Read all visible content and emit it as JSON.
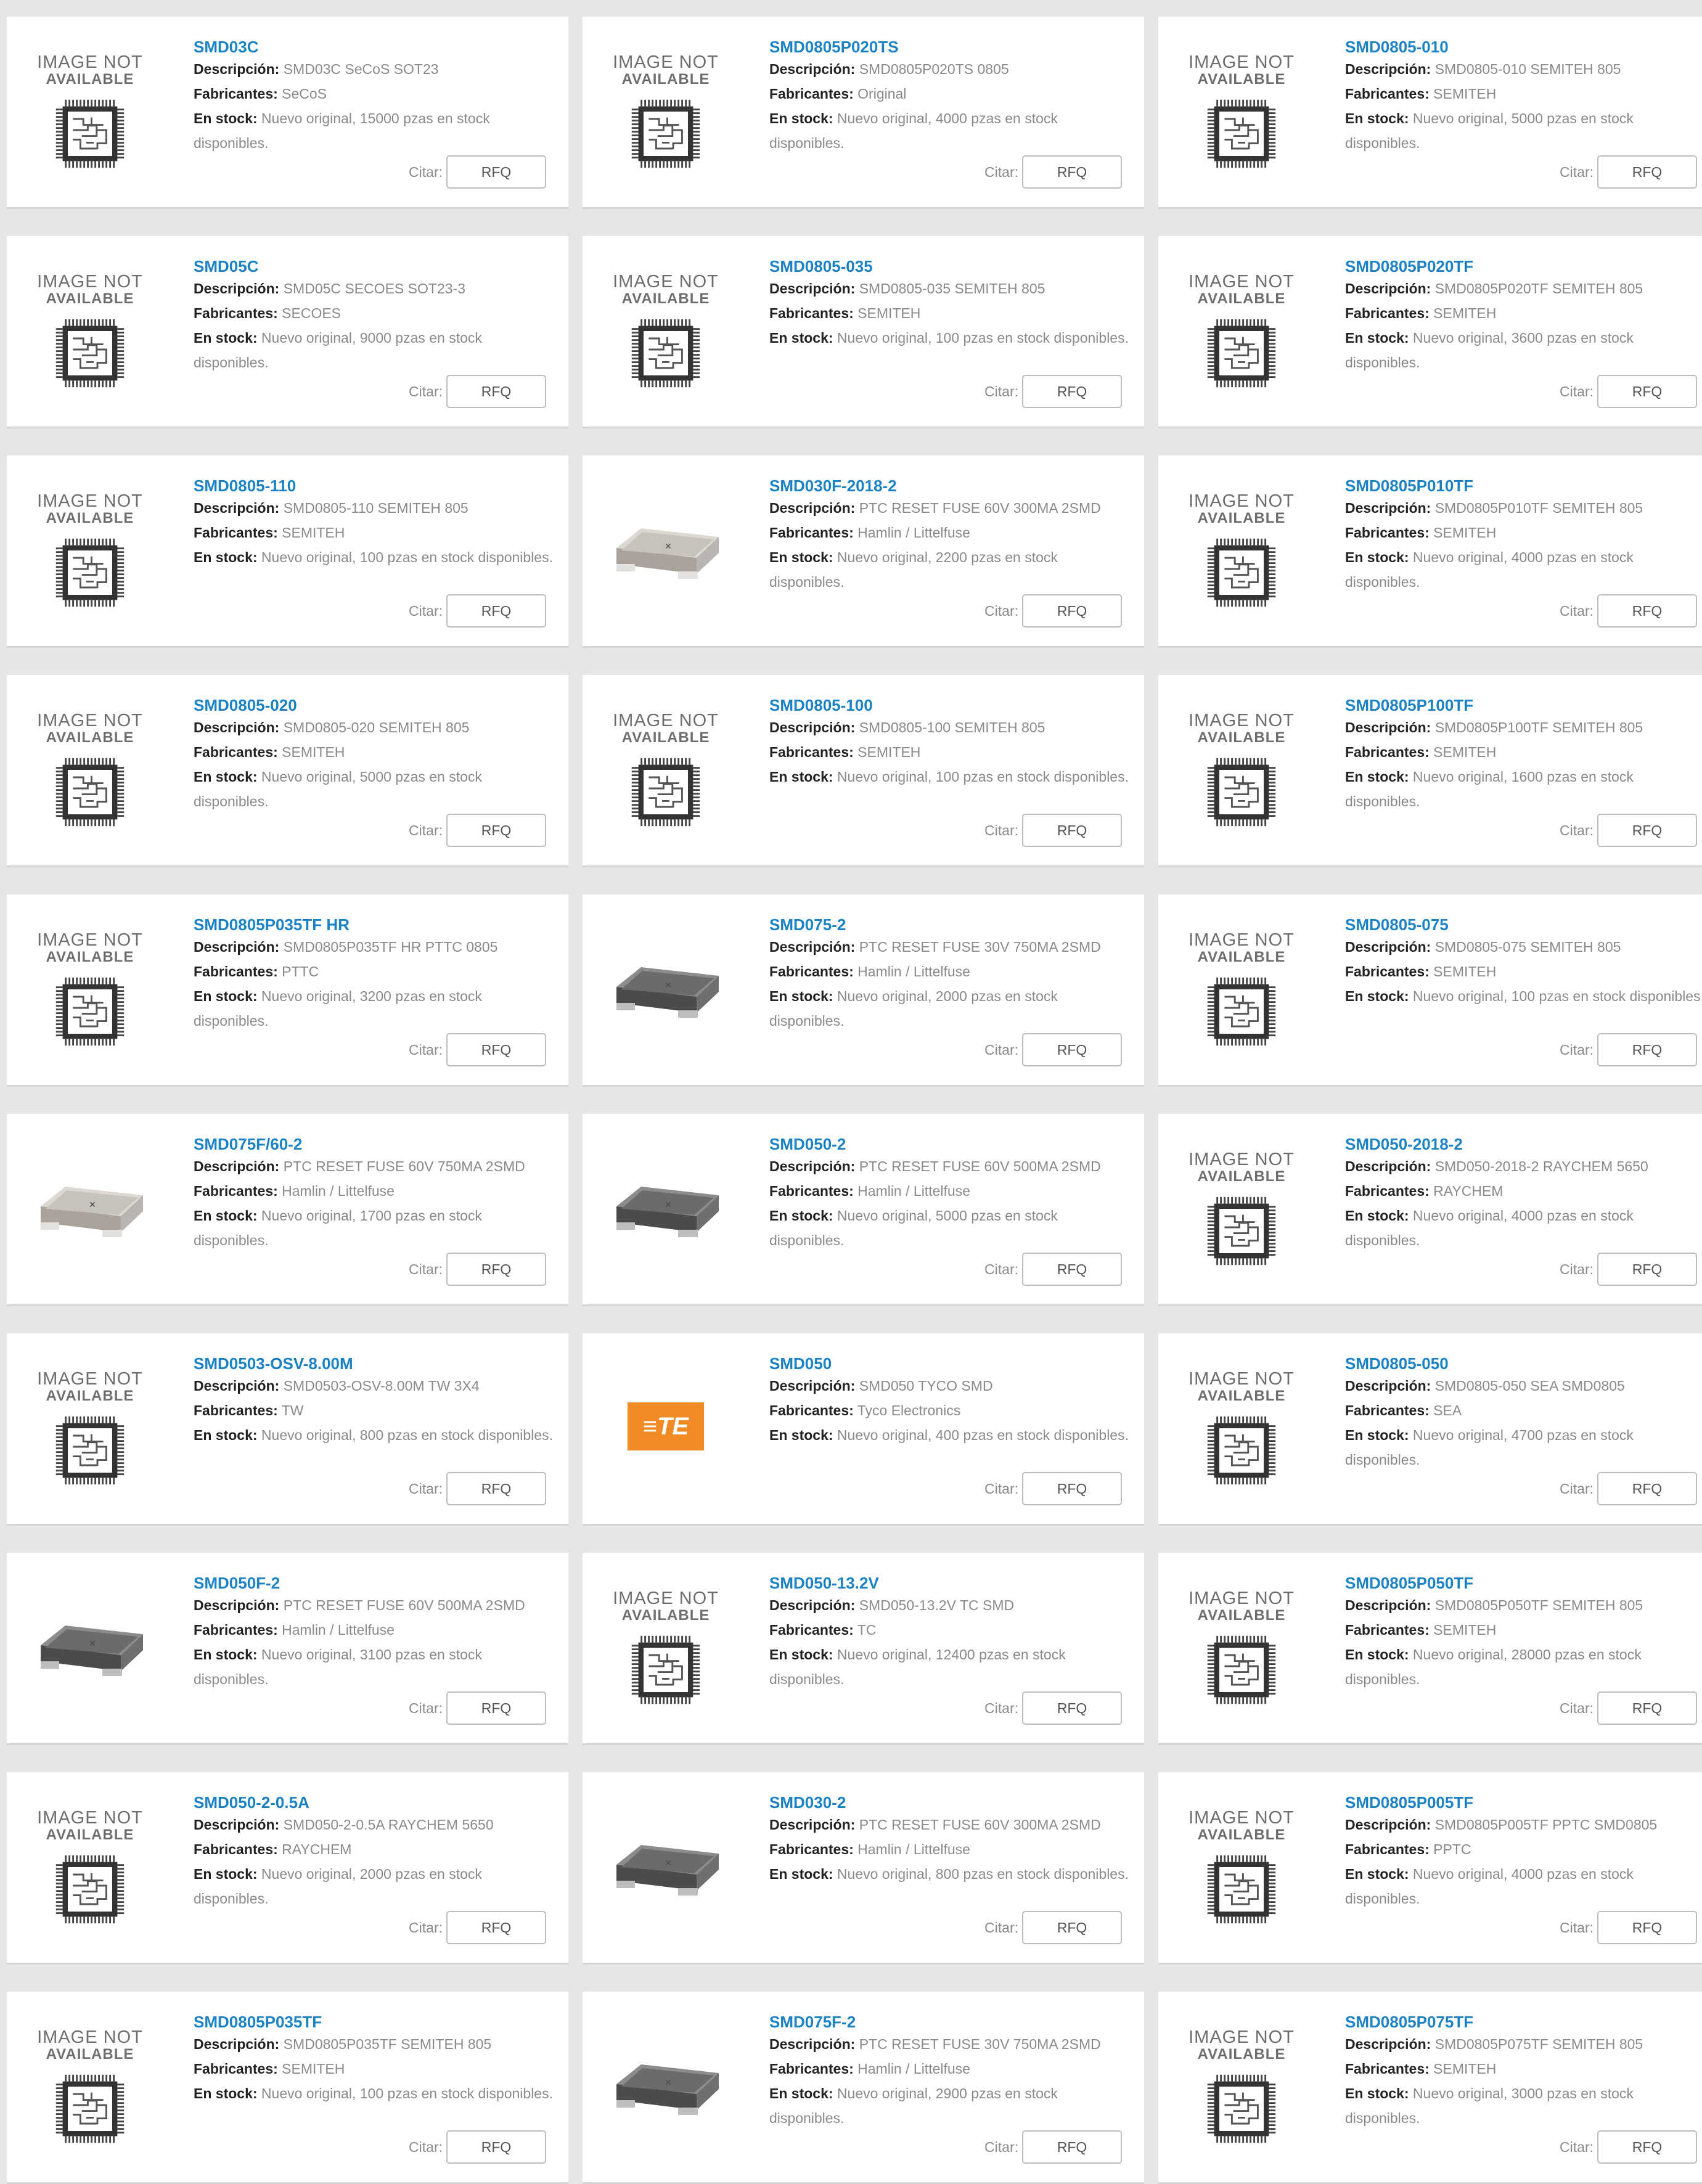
{
  "labels": {
    "description": "Descripción:",
    "manufacturers": "Fabricantes:",
    "in_stock": "En stock:",
    "cite": "Citar:",
    "rfq": "RFQ",
    "image_na_line1": "IMAGE NOT",
    "image_na_line2": "AVAILABLE",
    "te_logo_text": "≡TE"
  },
  "products": [
    {
      "name": "SMD03C",
      "description": "SMD03C SeCoS SOT23",
      "manufacturer": "SeCoS",
      "stock": "Nuevo original, 15000 pzas en stock disponibles.",
      "image": "not-available"
    },
    {
      "name": "SMD0805P020TS",
      "description": "SMD0805P020TS 0805",
      "manufacturer": "Original",
      "stock": "Nuevo original, 4000 pzas en stock disponibles.",
      "image": "not-available"
    },
    {
      "name": "SMD0805-010",
      "description": "SMD0805-010 SEMITEH 805",
      "manufacturer": "SEMITEH",
      "stock": "Nuevo original, 5000 pzas en stock disponibles.",
      "image": "not-available"
    },
    {
      "name": "SMD05C",
      "description": "SMD05C SECOES SOT23-3",
      "manufacturer": "SECOES",
      "stock": "Nuevo original, 9000 pzas en stock disponibles.",
      "image": "not-available"
    },
    {
      "name": "SMD0805-035",
      "description": "SMD0805-035 SEMITEH 805",
      "manufacturer": "SEMITEH",
      "stock": "Nuevo original, 100 pzas en stock disponibles.",
      "image": "not-available"
    },
    {
      "name": "SMD0805P020TF",
      "description": "SMD0805P020TF SEMITEH 805",
      "manufacturer": "SEMITEH",
      "stock": "Nuevo original, 3600 pzas en stock disponibles.",
      "image": "not-available"
    },
    {
      "name": "SMD0805-110",
      "description": "SMD0805-110 SEMITEH 805",
      "manufacturer": "SEMITEH",
      "stock": "Nuevo original, 100 pzas en stock disponibles.",
      "image": "not-available"
    },
    {
      "name": "SMD030F-2018-2",
      "description": "PTC RESET FUSE 60V 300MA 2SMD",
      "manufacturer": "Hamlin / Littelfuse",
      "stock": "Nuevo original, 2200 pzas en stock disponibles.",
      "image": "fuse-light"
    },
    {
      "name": "SMD0805P010TF",
      "description": "SMD0805P010TF SEMITEH 805",
      "manufacturer": "SEMITEH",
      "stock": "Nuevo original, 4000 pzas en stock disponibles.",
      "image": "not-available"
    },
    {
      "name": "SMD0805-020",
      "description": "SMD0805-020 SEMITEH 805",
      "manufacturer": "SEMITEH",
      "stock": "Nuevo original, 5000 pzas en stock disponibles.",
      "image": "not-available"
    },
    {
      "name": "SMD0805-100",
      "description": "SMD0805-100 SEMITEH 805",
      "manufacturer": "SEMITEH",
      "stock": "Nuevo original, 100 pzas en stock disponibles.",
      "image": "not-available"
    },
    {
      "name": "SMD0805P100TF",
      "description": "SMD0805P100TF SEMITEH 805",
      "manufacturer": "SEMITEH",
      "stock": "Nuevo original, 1600 pzas en stock disponibles.",
      "image": "not-available"
    },
    {
      "name": "SMD0805P035TF HR",
      "description": "SMD0805P035TF HR PTTC 0805",
      "manufacturer": "PTTC",
      "stock": "Nuevo original, 3200 pzas en stock disponibles.",
      "image": "not-available"
    },
    {
      "name": "SMD075-2",
      "description": "PTC RESET FUSE 30V 750MA 2SMD",
      "manufacturer": "Hamlin / Littelfuse",
      "stock": "Nuevo original, 2000 pzas en stock disponibles.",
      "image": "fuse-dark"
    },
    {
      "name": "SMD0805-075",
      "description": "SMD0805-075 SEMITEH 805",
      "manufacturer": "SEMITEH",
      "stock": "Nuevo original, 100 pzas en stock disponibles.",
      "image": "not-available"
    },
    {
      "name": "SMD075F/60-2",
      "description": "PTC RESET FUSE 60V 750MA 2SMD",
      "manufacturer": "Hamlin / Littelfuse",
      "stock": "Nuevo original, 1700 pzas en stock disponibles.",
      "image": "fuse-light"
    },
    {
      "name": "SMD050-2",
      "description": "PTC RESET FUSE 60V 500MA 2SMD",
      "manufacturer": "Hamlin / Littelfuse",
      "stock": "Nuevo original, 5000 pzas en stock disponibles.",
      "image": "fuse-dark"
    },
    {
      "name": "SMD050-2018-2",
      "description": "SMD050-2018-2 RAYCHEM 5650",
      "manufacturer": "RAYCHEM",
      "stock": "Nuevo original, 4000 pzas en stock disponibles.",
      "image": "not-available"
    },
    {
      "name": "SMD0503-OSV-8.00M",
      "description": "SMD0503-OSV-8.00M TW 3X4",
      "manufacturer": "TW",
      "stock": "Nuevo original, 800 pzas en stock disponibles.",
      "image": "not-available"
    },
    {
      "name": "SMD050",
      "description": "SMD050 TYCO SMD",
      "manufacturer": "Tyco Electronics",
      "stock": "Nuevo original, 400 pzas en stock disponibles.",
      "image": "te-logo"
    },
    {
      "name": "SMD0805-050",
      "description": "SMD0805-050 SEA SMD0805",
      "manufacturer": "SEA",
      "stock": "Nuevo original, 4700 pzas en stock disponibles.",
      "image": "not-available"
    },
    {
      "name": "SMD050F-2",
      "description": "PTC RESET FUSE 60V 500MA 2SMD",
      "manufacturer": "Hamlin / Littelfuse",
      "stock": "Nuevo original, 3100 pzas en stock disponibles.",
      "image": "fuse-dark"
    },
    {
      "name": "SMD050-13.2V",
      "description": "SMD050-13.2V TC SMD",
      "manufacturer": "TC",
      "stock": "Nuevo original, 12400 pzas en stock disponibles.",
      "image": "not-available"
    },
    {
      "name": "SMD0805P050TF",
      "description": "SMD0805P050TF SEMITEH 805",
      "manufacturer": "SEMITEH",
      "stock": "Nuevo original, 28000 pzas en stock disponibles.",
      "image": "not-available"
    },
    {
      "name": "SMD050-2-0.5A",
      "description": "SMD050-2-0.5A RAYCHEM 5650",
      "manufacturer": "RAYCHEM",
      "stock": "Nuevo original, 2000 pzas en stock disponibles.",
      "image": "not-available"
    },
    {
      "name": "SMD030-2",
      "description": "PTC RESET FUSE 60V 300MA 2SMD",
      "manufacturer": "Hamlin / Littelfuse",
      "stock": "Nuevo original, 800 pzas en stock disponibles.",
      "image": "fuse-dark"
    },
    {
      "name": "SMD0805P005TF",
      "description": "SMD0805P005TF PPTC SMD0805",
      "manufacturer": "PPTC",
      "stock": "Nuevo original, 4000 pzas en stock disponibles.",
      "image": "not-available"
    },
    {
      "name": "SMD0805P035TF",
      "description": "SMD0805P035TF SEMITEH 805",
      "manufacturer": "SEMITEH",
      "stock": "Nuevo original, 100 pzas en stock disponibles.",
      "image": "not-available"
    },
    {
      "name": "SMD075F-2",
      "description": "PTC RESET FUSE 30V 750MA 2SMD",
      "manufacturer": "Hamlin / Littelfuse",
      "stock": "Nuevo original, 2900 pzas en stock disponibles.",
      "image": "fuse-dark"
    },
    {
      "name": "SMD0805P075TF",
      "description": "SMD0805P075TF SEMITEH 805",
      "manufacturer": "SEMITEH",
      "stock": "Nuevo original, 3000 pzas en stock disponibles.",
      "image": "not-available"
    }
  ]
}
